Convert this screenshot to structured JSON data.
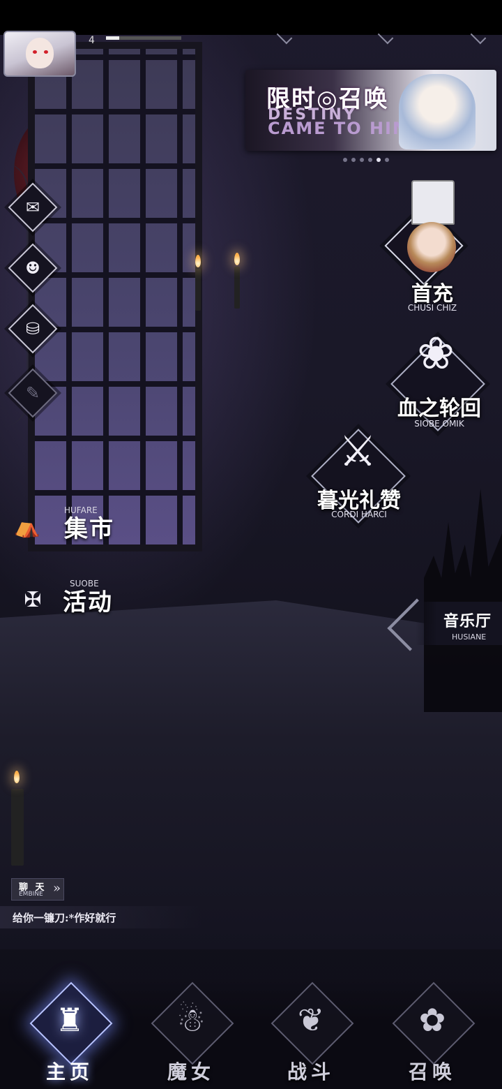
{
  "player": {
    "level": "4",
    "xp_progress": 0.18
  },
  "banner": {
    "title": "限时◎召唤",
    "subtitle_line1": "DESTINY",
    "subtitle_line2": "CAME TO HIM",
    "page_count": 6,
    "active_page": 5
  },
  "side_menu": [
    {
      "name": "mail",
      "glyph": "✉"
    },
    {
      "name": "friends",
      "glyph": "☻"
    },
    {
      "name": "bag",
      "glyph": "⛁"
    },
    {
      "name": "scroll",
      "glyph": "✎"
    }
  ],
  "left_menu": {
    "market": {
      "label": "集市",
      "sub": "HUFARE",
      "glyph": "⛺"
    },
    "events": {
      "label": "活动",
      "sub": "SUOBE",
      "glyph": "✠"
    }
  },
  "features": {
    "first_recharge": {
      "label": "首充",
      "sub": "CHUSI CHIZ"
    },
    "blood_cycle": {
      "label": "血之轮回",
      "sub": "SIOBE OMIK",
      "glyph": "❀"
    },
    "twilight_praise": {
      "label": "暮光礼赞",
      "sub": "CORDI HARCI",
      "glyph": "⚔"
    },
    "music_hall": {
      "label": "音乐厅",
      "sub": "HUSIANE"
    }
  },
  "chat": {
    "tag_label": "聊 天",
    "tag_sub": "EMBINE",
    "arrow": "»",
    "latest_message": "给你一镰刀:*作好就行"
  },
  "bottom_nav": [
    {
      "label": "主页",
      "icon": "castle-icon",
      "glyph": "♜",
      "active": true
    },
    {
      "label": "魔女",
      "icon": "witch-icon",
      "glyph": "☃",
      "active": false
    },
    {
      "label": "战斗",
      "icon": "book-icon",
      "glyph": "❦",
      "active": false
    },
    {
      "label": "召唤",
      "icon": "summon-icon",
      "glyph": "✿",
      "active": false
    }
  ]
}
